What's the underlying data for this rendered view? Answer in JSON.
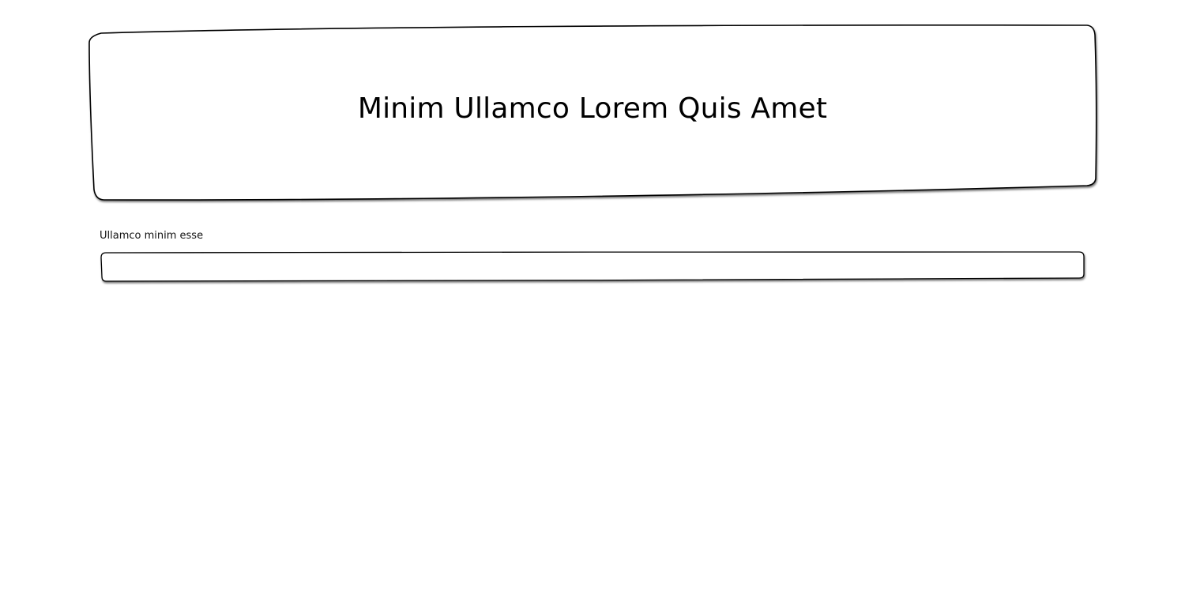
{
  "header": {
    "title": "Minim Ullamco Lorem Quis Amet"
  },
  "form": {
    "field_label": "Ullamco minim esse",
    "field_value": ""
  }
}
